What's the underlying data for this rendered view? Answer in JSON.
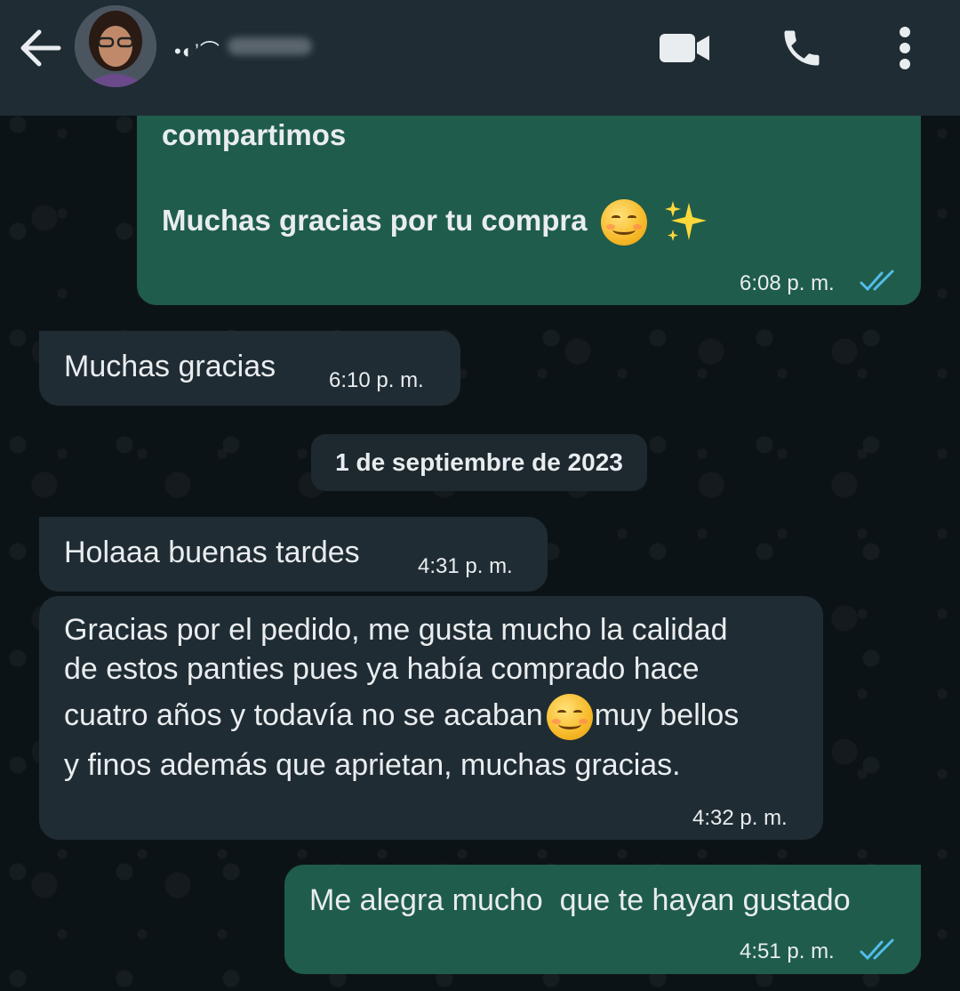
{
  "header": {
    "contact_name": "•◐’⌒"
  },
  "messages": [
    {
      "id": "m1",
      "lines": [
        "compartimos",
        "",
        "Muchas gracias por tu compra"
      ],
      "time": "6:08 p. m."
    },
    {
      "id": "m2",
      "text": "Muchas gracias",
      "time": "6:10 p. m."
    },
    {
      "id": "m3",
      "text": "Holaaa buenas tardes",
      "time": "4:31 p. m."
    },
    {
      "id": "m4",
      "lines": [
        "Gracias por el pedido, me gusta mucho la calidad",
        "de estos panties pues ya había comprado hace",
        "cuatro años y todavía no se acaban",
        "muy bellos",
        "y finos además que aprietan, muchas gracias."
      ],
      "time": "4:32 p. m."
    },
    {
      "id": "m5",
      "text": "Me alegra mucho  que te hayan gustado",
      "time": "4:51 p. m."
    }
  ],
  "date_separator": "1 de septiembre de 2023",
  "colors": {
    "header_bg": "#1f2c33",
    "outgoing_bubble": "#1f5c4b",
    "incoming_bubble": "#202c33",
    "read_ticks": "#53bdeb",
    "text": "#e9edef"
  },
  "icons": [
    "back-arrow-icon",
    "video-call-icon",
    "phone-icon",
    "more-vert-icon",
    "smiling-face-emoji",
    "sparkles-emoji",
    "double-check-icon"
  ]
}
